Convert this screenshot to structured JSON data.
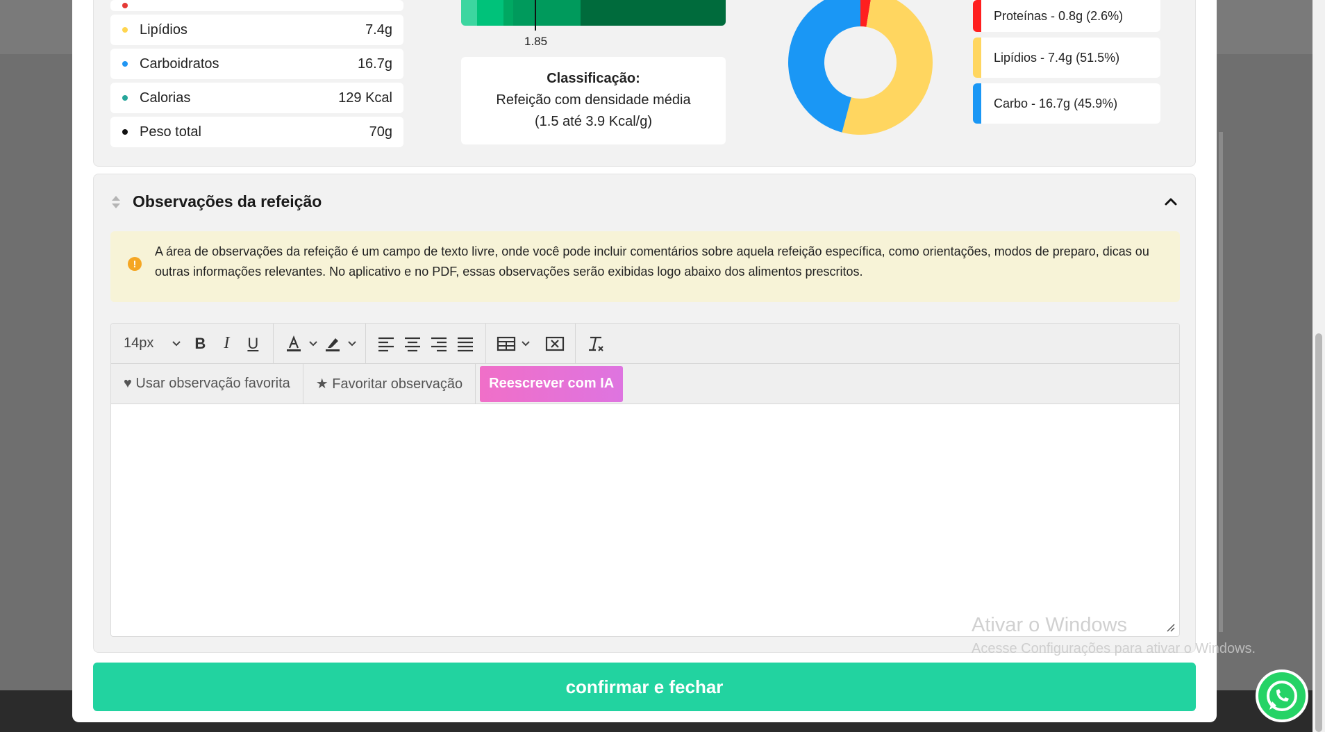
{
  "macros": [
    {
      "name": "",
      "value": "",
      "color": "#e53935"
    },
    {
      "name": "Lipídios",
      "value": "7.4g",
      "color": "#ffd54f"
    },
    {
      "name": "Carboidratos",
      "value": "16.7g",
      "color": "#2196f3"
    },
    {
      "name": "Calorias",
      "value": "129 Kcal",
      "color": "#26a69a"
    },
    {
      "name": "Peso total",
      "value": "70g",
      "color": "#111111"
    }
  ],
  "density": {
    "marker_value": "1.85",
    "segment_colors": [
      "#3cd6a0",
      "#00c27a",
      "#00a862",
      "#009a5c",
      "#006b3c"
    ]
  },
  "classification": {
    "title": "Classificação:",
    "line1": "Refeição com densidade média",
    "line2": "(1.5 até 3.9 Kcal/g)"
  },
  "chart_data": {
    "type": "pie",
    "categories": [
      "Proteínas",
      "Lipídios",
      "Carbo"
    ],
    "values": [
      2.6,
      51.5,
      45.9
    ],
    "colors": [
      "#ff1f1f",
      "#ffd660",
      "#1a97f5"
    ],
    "title": "",
    "legend_position": "right"
  },
  "legend": [
    {
      "label": "Proteínas - 0.8g (2.6%)",
      "color": "#ff1f1f"
    },
    {
      "label": "Lipídios - 7.4g (51.5%)",
      "color": "#ffd660"
    },
    {
      "label": "Carbo - 16.7g (45.9%)",
      "color": "#1a97f5"
    }
  ],
  "observations": {
    "title": "Observações da refeição",
    "info_icon": "info-icon",
    "info_text": "A área de observações da refeição é um campo de texto livre, onde você pode incluir comentários sobre aquela refeição específica, como orientações, modos de preparo, dicas ou outras informações relevantes. No aplicativo e no PDF, essas observações serão exibidas logo abaixo dos alimentos prescritos.",
    "toolbar": {
      "font_size": "14px"
    },
    "actions": {
      "use_favorite": "♥ Usar observação favorita",
      "favorite": "★ Favoritar observação",
      "ai_rewrite": "Reescrever com IA"
    },
    "content": ""
  },
  "confirm_button": "confirmar e fechar",
  "watermark": {
    "line1": "Ativar o Windows",
    "line2": "Acesse Configurações para ativar o Windows."
  }
}
